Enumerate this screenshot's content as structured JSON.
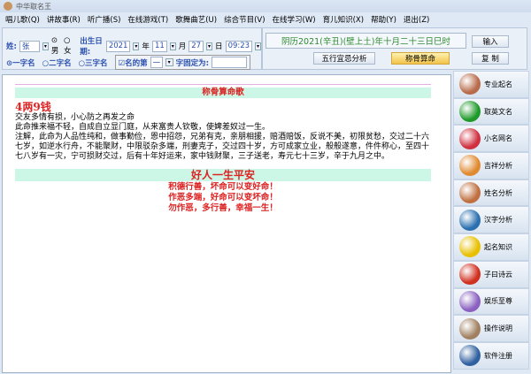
{
  "window": {
    "title": "中华取名王"
  },
  "menu": [
    "唱儿歌(Q)",
    "讲故事(R)",
    "听广播(S)",
    "在线游戏(T)",
    "歌舞曲艺(U)",
    "综合节目(V)",
    "在线学习(W)",
    "育儿知识(X)",
    "帮助(Y)",
    "退出(Z)"
  ],
  "form": {
    "surname_label": "姓:",
    "surname": "张",
    "male": "男",
    "female": "女",
    "gender_selected": "男",
    "birth_label": "出生日期:",
    "year": "2021",
    "year_unit": "年",
    "month": "11",
    "month_unit": "月",
    "day": "27",
    "day_unit": "日",
    "time": "09:23",
    "name_len": [
      "一字名",
      "二字名",
      "三字名"
    ],
    "name_len_selected": "一字名",
    "fix_label": "名的第",
    "fix_pos": "一",
    "fix_label2": "字固定为:",
    "fix_value": ""
  },
  "lunar": "阴历2021(辛丑)(壁上土)年十月二十三日巳时",
  "buttons": {
    "wuxing": "五行宜忌分析",
    "chenggu": "称骨算命",
    "input": "输入",
    "copy": "复 制"
  },
  "result": {
    "heading": "称骨算命歌",
    "weight": "4两9钱",
    "lines": [
      "交友多情有损，小心防之再发之命",
      "此命推来福不轻，自成自立显门庭，从来富贵人钦敬，使婢差奴过一生。",
      "注解，此命为人品性纯和，做事勤俭，恩中招怨，兄弟有克，亲朋相援，赔酒赔饭，反说不美，初限贫愁，交过二十六七岁，如逆水行舟，不能聚财，中限驳杂多端，刑妻克子，交过四十岁，方可成家立业，般般遂意，件件称心，至四十七八岁有一灾，宁可损财交过，后有十年好运来，家中钱财聚，三子送老，寿元七十三岁，辛于九月之中。"
    ],
    "motto": "好人一生平安",
    "verses": [
      "积德行善，坏命可以变好命！",
      "作恶多端，好命可以变坏命！",
      "勿作恶，多行善，幸福一生！"
    ]
  },
  "sidebar": [
    {
      "label": "专业起名",
      "icon": "woman-avatar-icon",
      "color": "#b86b4a"
    },
    {
      "label": "取英文名",
      "icon": "green-book-icon",
      "color": "#1f9a2a"
    },
    {
      "label": "小名网名",
      "icon": "heart-folder-icon",
      "color": "#d03040"
    },
    {
      "label": "吉祥分析",
      "icon": "compass-icon",
      "color": "#e08a30"
    },
    {
      "label": "姓名分析",
      "icon": "paint-icon",
      "color": "#c07040"
    },
    {
      "label": "汉字分析",
      "icon": "books-icon",
      "color": "#2a70b0"
    },
    {
      "label": "起名知识",
      "icon": "disc-icon",
      "color": "#e8c000"
    },
    {
      "label": "子曰诗云",
      "icon": "knot-icon",
      "color": "#d03020"
    },
    {
      "label": "娱乐至尊",
      "icon": "music-icon",
      "color": "#8a60c0"
    },
    {
      "label": "操作说明",
      "icon": "signpost-icon",
      "color": "#a08060"
    },
    {
      "label": "软件注册",
      "icon": "key-icon",
      "color": "#3060a0"
    }
  ]
}
